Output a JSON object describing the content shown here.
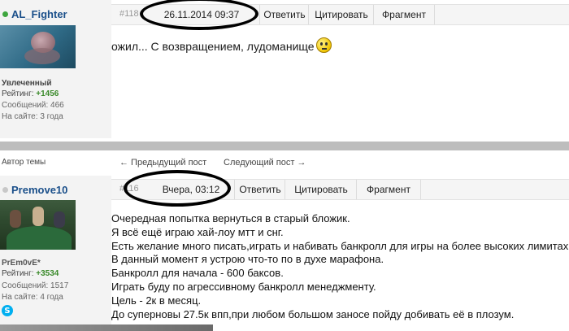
{
  "post1": {
    "username": "AL_Fighter",
    "status": "Увлеченный",
    "rating_label": "Рейтинг:",
    "rating_value": "+1456",
    "messages_label": "Сообщений:",
    "messages_value": "466",
    "onsite_label": "На сайте:",
    "onsite_value": "3 года",
    "post_number": "#118",
    "datetime": "26.11.2014 09:37",
    "reply_label": "Ответить",
    "quote_label": "Цитировать",
    "fragment_label": "Фрагмент",
    "message": "ожил... С возвращением, лудоманище"
  },
  "divider": {
    "author_label": "Автор темы",
    "prev_post": "← Предыдущий пост",
    "next_post": "Следующий пост →"
  },
  "post2": {
    "username": "Premove10",
    "status": "PrEm0vE*",
    "rating_label": "Рейтинг:",
    "rating_value": "+3534",
    "messages_label": "Сообщений:",
    "messages_value": "1517",
    "onsite_label": "На сайте:",
    "onsite_value": "4 года",
    "post_number": "#116",
    "datetime": "Вчера, 03:12",
    "reply_label": "Ответить",
    "quote_label": "Цитировать",
    "fragment_label": "Фрагмент",
    "lines": [
      "Очередная попытка вернуться в старый бложик.",
      "Я всё ещё играю хай-лоу мтт и снг.",
      "Есть желание много писать,играть и набивать банкролл для игры на более высоких лимитах.",
      "В данный момент я устрою что-то по в духе марафона.",
      "Банкролл для начала - 600 баксов.",
      "Играть буду по агрессивному банкролл менеджменту.",
      "Цель - 2к в месяц.",
      "До суперновы 27.5к впп,при любом большом заносе пойду добивать её в плозум."
    ]
  },
  "icons": {
    "smiley": "thinking-smiley-icon",
    "skype": "skype-icon"
  },
  "colors": {
    "username": "#1a4f8a",
    "rating": "#3a8a2a",
    "online": "#3fa63f"
  }
}
